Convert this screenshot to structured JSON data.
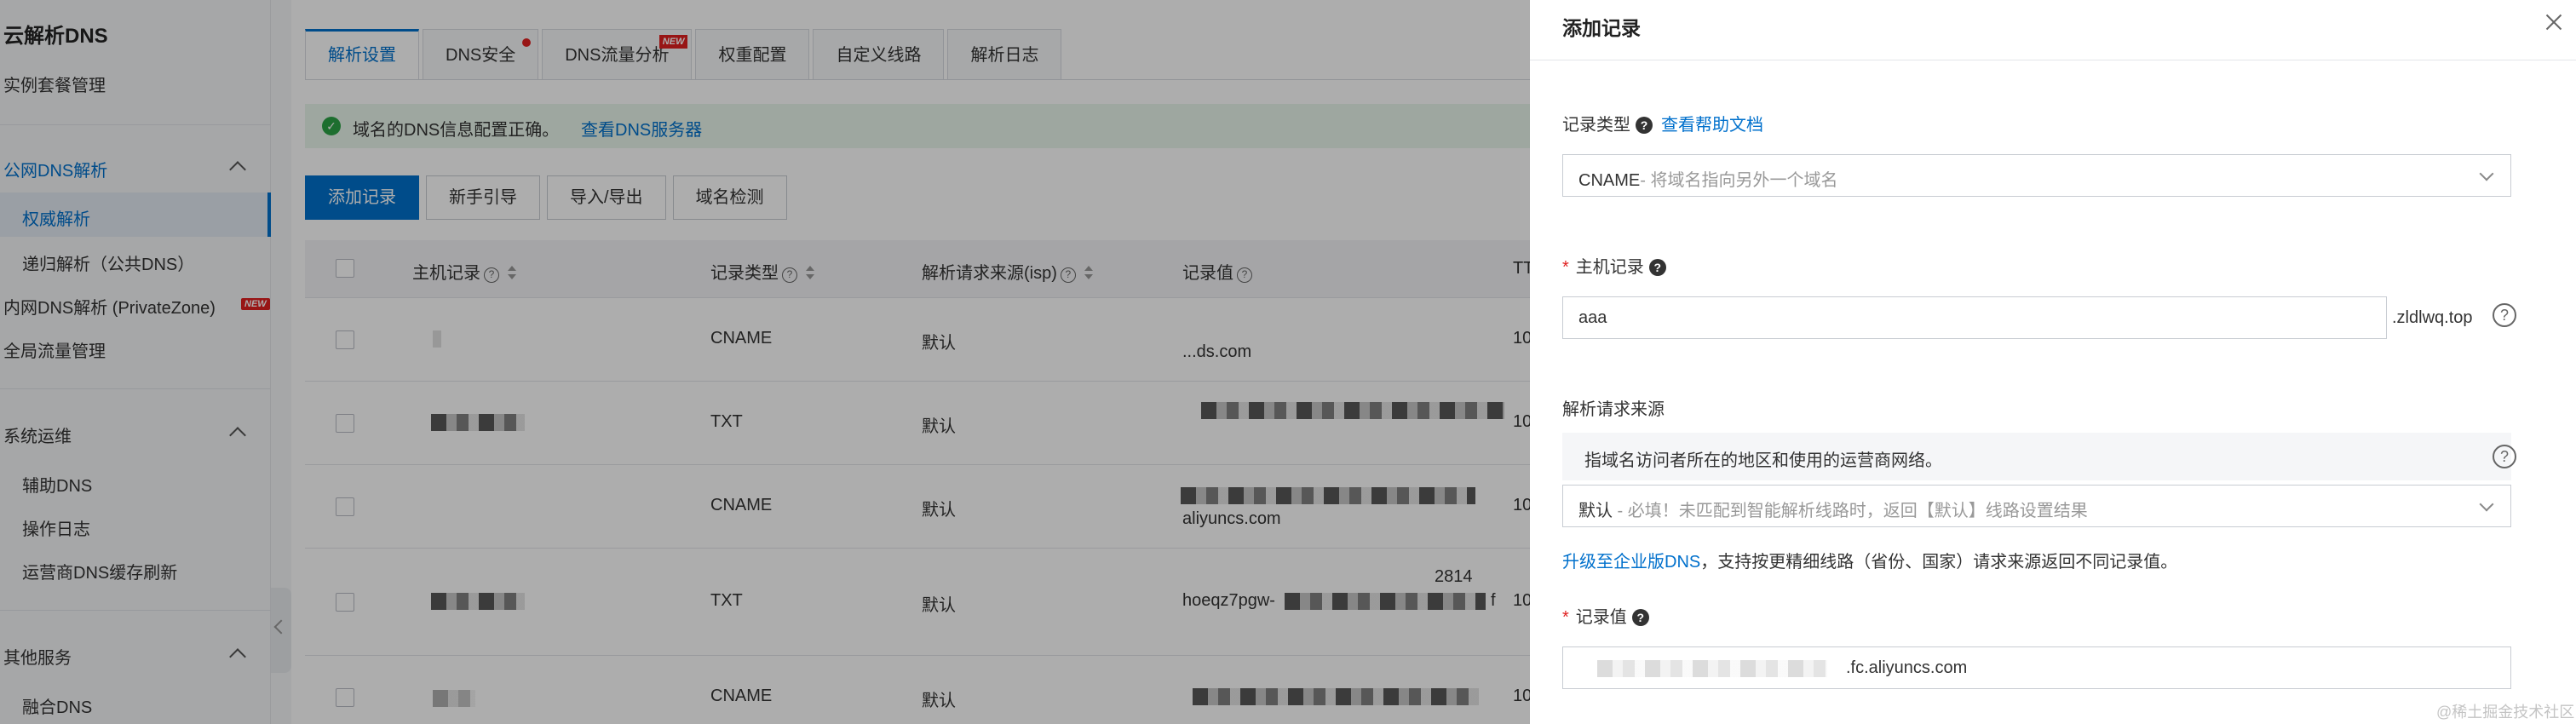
{
  "sidebar": {
    "title": "云解析DNS",
    "item_instance": "实例套餐管理",
    "group_public": "公网DNS解析",
    "item_authoritative": "权威解析",
    "item_recursive": "递归解析（公共DNS）",
    "item_private": "内网DNS解析 (PrivateZone)",
    "new_badge": "NEW",
    "item_global_traffic": "全局流量管理",
    "group_ops": "系统运维",
    "item_aux_dns": "辅助DNS",
    "item_oplog": "操作日志",
    "item_cache_refresh": "运营商DNS缓存刷新",
    "group_other": "其他服务",
    "item_fusion": "融合DNS"
  },
  "tabs": [
    {
      "label": "解析设置",
      "active": true
    },
    {
      "label": "DNS安全",
      "dot": true
    },
    {
      "label": "DNS流量分析",
      "badge": "NEW"
    },
    {
      "label": "权重配置"
    },
    {
      "label": "自定义线路"
    },
    {
      "label": "解析日志"
    }
  ],
  "notice": {
    "text": "域名的DNS信息配置正确。",
    "link": "查看DNS服务器"
  },
  "toolbar": {
    "add": "添加记录",
    "guide": "新手引导",
    "import_export": "导入/导出",
    "check": "域名检测"
  },
  "table": {
    "headers": {
      "host": "主机记录",
      "type": "记录类型",
      "isp": "解析请求来源(isp)",
      "value": "记录值",
      "ttl": "TT"
    },
    "rows": [
      {
        "type": "CNAME",
        "isp": "默认",
        "value_tail": "...ds.com",
        "ttl": "10"
      },
      {
        "type": "TXT",
        "isp": "默认",
        "value_tail": "",
        "ttl": "10"
      },
      {
        "type": "CNAME",
        "isp": "默认",
        "value_tail": "aliyuncs.com",
        "ttl": "10"
      },
      {
        "type": "TXT",
        "isp": "默认",
        "value_tail": "hoeqz7pgw-",
        "value_extra": "2814",
        "value_extra2": "f",
        "ttl": "10"
      },
      {
        "type": "CNAME",
        "isp": "默认",
        "value_tail": "",
        "ttl": "10"
      }
    ]
  },
  "drawer": {
    "title": "添加记录",
    "record_type_label": "记录类型",
    "help_doc_link": "查看帮助文档",
    "record_type_value": "CNAME",
    "record_type_hint": "- 将域名指向另外一个域名",
    "host_label": "主机记录",
    "host_value": "aaa",
    "host_suffix": ".zldlwq.top",
    "source_label": "解析请求来源",
    "source_info": "指域名访问者所在的地区和使用的运营商网络。",
    "source_value": "默认",
    "source_hint": " - 必填！未匹配到智能解析线路时，返回【默认】线路设置结果",
    "upgrade_link": "升级至企业版DNS",
    "upgrade_text": "，支持按更精细线路（省份、国家）请求来源返回不同记录值。",
    "value_label": "记录值",
    "value_suffix": ".fc.aliyuncs.com"
  },
  "watermark": "@稀土掘金技术社区"
}
